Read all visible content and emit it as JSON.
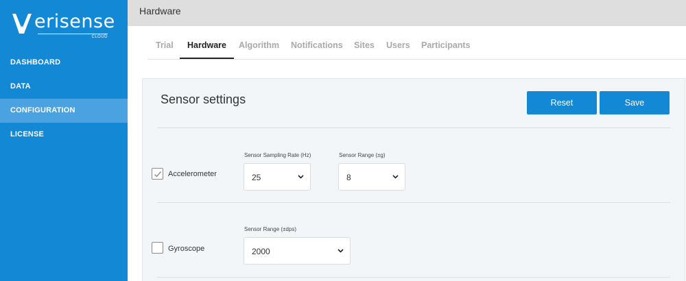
{
  "brand": {
    "logo_text": "erisense",
    "logo_sub": "CLOUD"
  },
  "sidebar": {
    "items": [
      {
        "label": "DASHBOARD",
        "active": false
      },
      {
        "label": "DATA",
        "active": false
      },
      {
        "label": "CONFIGURATION",
        "active": true
      },
      {
        "label": "LICENSE",
        "active": false
      }
    ]
  },
  "header": {
    "title": "Hardware"
  },
  "tabs": [
    {
      "label": "Trial",
      "active": false
    },
    {
      "label": "Hardware",
      "active": true
    },
    {
      "label": "Algorithm",
      "active": false
    },
    {
      "label": "Notifications",
      "active": false
    },
    {
      "label": "Sites",
      "active": false
    },
    {
      "label": "Users",
      "active": false
    },
    {
      "label": "Participants",
      "active": false
    }
  ],
  "panel": {
    "title": "Sensor settings",
    "reset_label": "Reset",
    "save_label": "Save"
  },
  "sensors": {
    "accelerometer": {
      "label": "Accelerometer",
      "checked": true,
      "rate_label": "Sensor Sampling Rate (Hz)",
      "rate_value": "25",
      "range_label": "Sensor Range (±g)",
      "range_value": "8"
    },
    "gyroscope": {
      "label": "Gyroscope",
      "checked": false,
      "range_label": "Sensor Range (±dps)",
      "range_value": "2000"
    }
  },
  "colors": {
    "sidebar_bg": "#1388d4",
    "sidebar_active": "#4aa3e0",
    "button_bg": "#1388d4",
    "panel_bg": "#f3f6f9",
    "header_bg": "#dedede"
  }
}
